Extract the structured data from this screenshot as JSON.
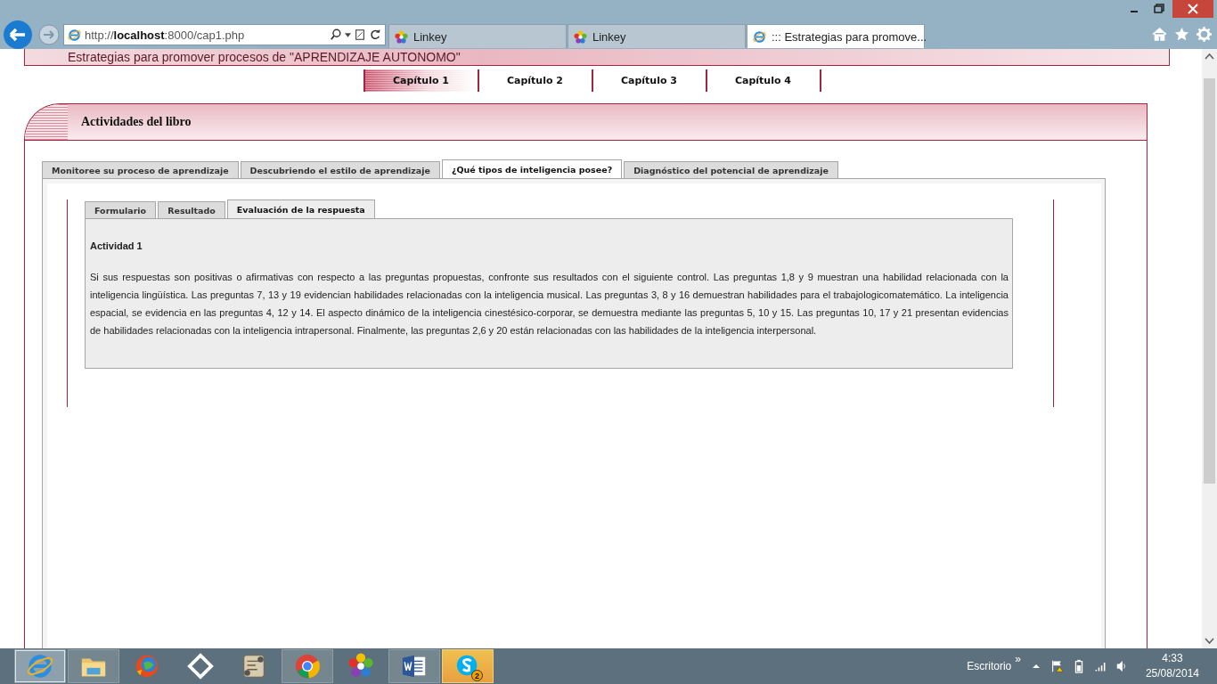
{
  "browser": {
    "address": "http://**localhost**:8000/cap1.php",
    "tabs": [
      {
        "title": "Linkey",
        "kind": "flower",
        "selected": false
      },
      {
        "title": "Linkey",
        "kind": "flower",
        "selected": false
      },
      {
        "title": "::: Estrategias para promove...",
        "kind": "ie",
        "selected": true
      }
    ]
  },
  "banner": {
    "title": "Estrategias para promover procesos de \"APRENDIZAJE AUTONOMO\""
  },
  "chapters": [
    {
      "label": "Capítulo 1",
      "selected": true
    },
    {
      "label": "Capítulo 2",
      "selected": false
    },
    {
      "label": "Capítulo 3",
      "selected": false
    },
    {
      "label": "Capítulo 4",
      "selected": false
    }
  ],
  "panel": {
    "title": "Actividades del libro",
    "tabs": [
      {
        "label": "Monitoree su proceso de aprendizaje",
        "selected": false
      },
      {
        "label": "Descubriendo el estilo de aprendizaje",
        "selected": false
      },
      {
        "label": "¿Qué tipos de inteligencia posee?",
        "selected": true
      },
      {
        "label": "Diagnóstico del potencial de aprendizaje",
        "selected": false
      }
    ],
    "subtabs": [
      {
        "label": "Formulario",
        "selected": false
      },
      {
        "label": "Resultado",
        "selected": false
      },
      {
        "label": "Evaluación de la respuesta",
        "selected": true
      }
    ],
    "heading": "Actividad 1",
    "text": "Si sus respuestas son positivas o afirmativas con respecto a las preguntas propuestas, confronte sus resultados con el siguiente control. Las preguntas 1,8 y 9 muestran una habilidad relacionada con la inteligencia lingüística. Las preguntas 7, 13 y 19 evidencian habilidades relacionadas con la inteligencia musical. Las preguntas 3, 8 y 16 demuestran habilidades para el trabajologicomatemático. La inteligencia espacial, se evidencia en las preguntas 4, 12 y 14. El aspecto dinámico de la inteligencia cinestésico-corporar, se demuestra mediante las preguntas 5, 10 y 15. Las preguntas 10, 17 y 21 presentan evidencias de habilidades relacionadas con la inteligencia intrapersonal. Finalmente, las preguntas 2,6 y 20 están relacionadas con las habilidades de la inteligencia interpersonal."
  },
  "taskbar": {
    "apps": [
      {
        "kind": "ie",
        "selected": true,
        "running": true,
        "alert": false
      },
      {
        "kind": "explorer",
        "selected": false,
        "running": true,
        "alert": false
      },
      {
        "kind": "media",
        "selected": false,
        "running": false,
        "alert": false
      },
      {
        "kind": "sync",
        "selected": false,
        "running": false,
        "alert": false
      },
      {
        "kind": "notes",
        "selected": false,
        "running": false,
        "alert": false
      },
      {
        "kind": "chrome",
        "selected": false,
        "running": true,
        "alert": false
      },
      {
        "kind": "flower",
        "selected": false,
        "running": false,
        "alert": false
      },
      {
        "kind": "word",
        "selected": false,
        "running": true,
        "alert": false
      },
      {
        "kind": "skype",
        "selected": false,
        "running": true,
        "alert": true,
        "badge": "2"
      }
    ],
    "desktop_label": "Escritorio",
    "more": "»",
    "time": "4:33",
    "date": "25/08/2014"
  }
}
